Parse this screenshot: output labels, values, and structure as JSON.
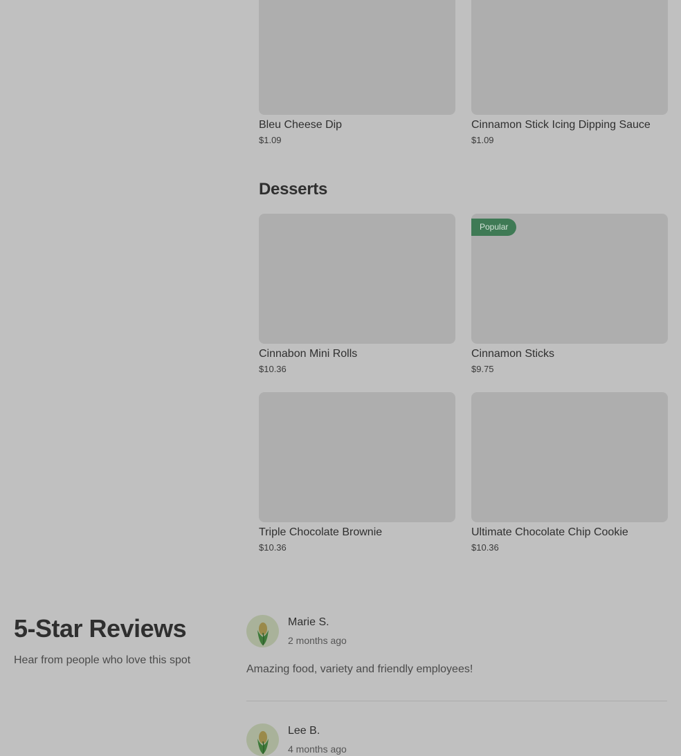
{
  "menu": {
    "top_items": [
      {
        "name": "Bleu Cheese Dip",
        "price": "$1.09"
      },
      {
        "name": "Cinnamon Stick Icing Dipping Sauce",
        "price": "$1.09"
      }
    ],
    "desserts": {
      "title": "Desserts",
      "items": [
        {
          "name": "Cinnabon Mini Rolls",
          "price": "$10.36",
          "badge": ""
        },
        {
          "name": "Cinnamon Sticks",
          "price": "$9.75",
          "badge": "Popular"
        },
        {
          "name": "Triple Chocolate Brownie",
          "price": "$10.36",
          "badge": ""
        },
        {
          "name": "Ultimate Chocolate Chip Cookie",
          "price": "$10.36",
          "badge": ""
        }
      ]
    }
  },
  "reviews": {
    "title": "5-Star Reviews",
    "subtitle": "Hear from people who love this spot",
    "items": [
      {
        "name": "Marie S.",
        "date": "2 months ago",
        "text": "Amazing food, variety and friendly employees!",
        "avatar_icon": "corn-icon"
      },
      {
        "name": "Lee B.",
        "date": "4 months ago",
        "text": "",
        "avatar_icon": "corn-icon"
      }
    ]
  },
  "colors": {
    "overlay_background": "#c0c0c0",
    "image_placeholder": "#aeaeae",
    "badge_green": "#3f7a55"
  }
}
